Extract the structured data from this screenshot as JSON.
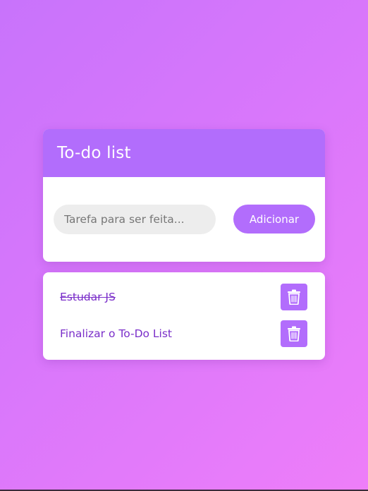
{
  "app": {
    "title": "To-do list"
  },
  "form": {
    "input_value": "",
    "input_placeholder": "Tarefa para ser feita...",
    "add_label": "Adicionar"
  },
  "tasks": [
    {
      "text": "Estudar JS",
      "completed": true,
      "delete_icon": "trash-icon"
    },
    {
      "text": "Finalizar o To-Do List",
      "completed": false,
      "delete_icon": "trash-icon"
    }
  ],
  "colors": {
    "accent": "#b26dfc",
    "task_text": "#7a2ec9",
    "input_bg": "#ededed"
  }
}
